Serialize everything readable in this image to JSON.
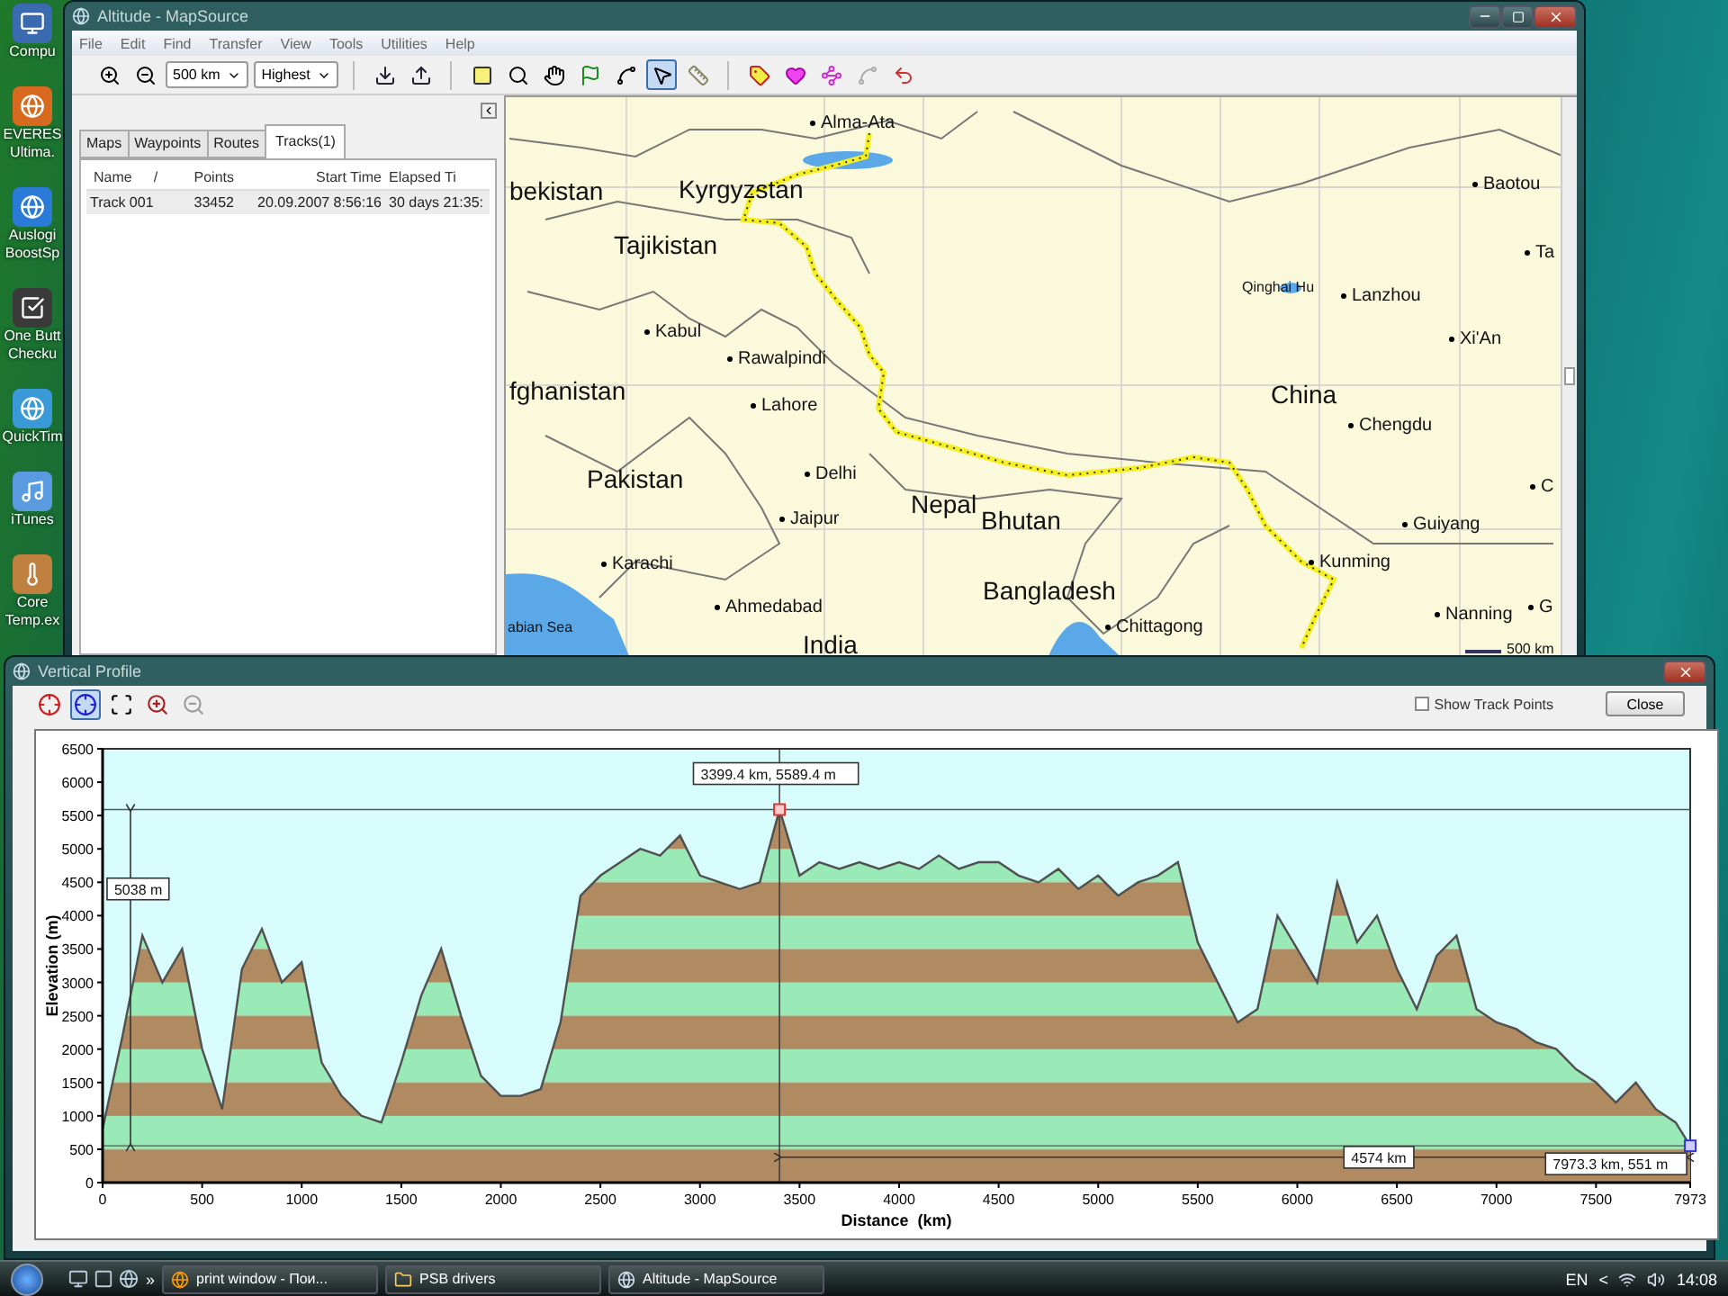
{
  "desktop_icons": [
    {
      "label": "Compu"
    },
    {
      "label": "EVERES Ultima."
    },
    {
      "label": "Auslogi BoostSp"
    },
    {
      "label": "One Butt Checku"
    },
    {
      "label": "QuickTim"
    },
    {
      "label": "iTunes"
    },
    {
      "label": "Core Temp.ex"
    }
  ],
  "mapsource": {
    "title": "Altitude - MapSource",
    "menu": [
      "File",
      "Edit",
      "Find",
      "Transfer",
      "View",
      "Tools",
      "Utilities",
      "Help"
    ],
    "scale_select": "500 km",
    "detail_select": "Highest",
    "tools": [
      {
        "selected": false
      },
      {
        "selected": false
      },
      {
        "selected": false
      },
      {
        "selected": false
      },
      {
        "selected": false
      },
      {
        "selected": false
      },
      {
        "selected": false
      },
      {
        "selected": false
      },
      {
        "selected": false
      },
      {
        "selected": true
      },
      {
        "selected": false
      },
      {
        "selected": false
      },
      {
        "selected": false
      },
      {
        "selected": false
      },
      {
        "selected": false
      },
      {
        "selected": false
      }
    ],
    "tabs": [
      {
        "label": "Maps",
        "selected": false
      },
      {
        "label": "Waypoints",
        "selected": false
      },
      {
        "label": "Routes",
        "selected": false
      },
      {
        "label": "Tracks(1)",
        "selected": true
      }
    ],
    "table": {
      "columns": [
        "Name",
        "Points",
        "Start Time",
        "Elapsed Ti"
      ],
      "sort_mark": "/",
      "rows": [
        [
          "Track 001",
          "33452",
          "20.09.2007 8:56:16",
          "30 days 21:35:"
        ]
      ]
    },
    "map": {
      "places": [
        {
          "kind": "city",
          "name": "Alma-Ata"
        },
        {
          "kind": "country",
          "name": "bekistan"
        },
        {
          "kind": "country",
          "name": "Kyrgyzstan"
        },
        {
          "kind": "city",
          "name": "Baotou"
        },
        {
          "kind": "country",
          "name": "Tajikistan"
        },
        {
          "kind": "city",
          "name": "Ta"
        },
        {
          "kind": "water",
          "name": "Qinghai Hu"
        },
        {
          "kind": "city",
          "name": "Lanzhou"
        },
        {
          "kind": "city",
          "name": "Kabul"
        },
        {
          "kind": "city",
          "name": "Xi'An"
        },
        {
          "kind": "city",
          "name": "Rawalpindi"
        },
        {
          "kind": "country",
          "name": "fghanistan"
        },
        {
          "kind": "country",
          "name": "China"
        },
        {
          "kind": "city",
          "name": "Lahore"
        },
        {
          "kind": "city",
          "name": "Chengdu"
        },
        {
          "kind": "country",
          "name": "Pakistan"
        },
        {
          "kind": "city",
          "name": "Delhi"
        },
        {
          "kind": "city",
          "name": "Jaipur"
        },
        {
          "kind": "country",
          "name": "Nepal"
        },
        {
          "kind": "country",
          "name": "Bhutan"
        },
        {
          "kind": "city",
          "name": "C"
        },
        {
          "kind": "city",
          "name": "Guiyang"
        },
        {
          "kind": "city",
          "name": "Karachi"
        },
        {
          "kind": "city",
          "name": "Kunming"
        },
        {
          "kind": "country",
          "name": "Bangladesh"
        },
        {
          "kind": "city",
          "name": "Ahmedabad"
        },
        {
          "kind": "city",
          "name": "Nanning"
        },
        {
          "kind": "city",
          "name": "G"
        },
        {
          "kind": "city",
          "name": "Chittagong"
        },
        {
          "kind": "water",
          "name": "abian Sea"
        },
        {
          "kind": "country",
          "name": "India"
        },
        {
          "kind": "scale",
          "name": "500 km"
        }
      ]
    }
  },
  "profile": {
    "title": "Vertical Profile",
    "tools": [
      {
        "selected": false,
        "disabled": false
      },
      {
        "selected": true,
        "disabled": false
      },
      {
        "selected": false,
        "disabled": false
      },
      {
        "selected": false,
        "disabled": false
      },
      {
        "selected": false,
        "disabled": true
      }
    ],
    "show_track_points": {
      "label": "Show Track Points",
      "checked": false
    },
    "close_button": "Close",
    "chart_data": {
      "type": "area",
      "xlabel": "Distance  (km)",
      "ylabel": "Elevation (m)",
      "x": [
        0,
        100,
        200,
        300,
        400,
        500,
        600,
        700,
        800,
        900,
        1000,
        1100,
        1200,
        1300,
        1400,
        1500,
        1600,
        1700,
        1800,
        1900,
        2000,
        2100,
        2200,
        2300,
        2400,
        2500,
        2600,
        2700,
        2800,
        2900,
        3000,
        3100,
        3200,
        3300,
        3400,
        3500,
        3600,
        3700,
        3800,
        3900,
        4000,
        4100,
        4200,
        4300,
        4400,
        4500,
        4600,
        4700,
        4800,
        4900,
        5000,
        5100,
        5200,
        5300,
        5400,
        5500,
        5600,
        5700,
        5800,
        5900,
        6000,
        6100,
        6200,
        6300,
        6400,
        6500,
        6600,
        6700,
        6800,
        6900,
        7000,
        7100,
        7200,
        7300,
        7400,
        7500,
        7600,
        7700,
        7800,
        7900,
        7973
      ],
      "series": [
        {
          "color": "#505050",
          "values": [
            800,
            2200,
            3700,
            3000,
            3500,
            2000,
            1100,
            3200,
            3800,
            3000,
            3300,
            1800,
            1300,
            1000,
            900,
            1800,
            2800,
            3500,
            2500,
            1600,
            1300,
            1300,
            1400,
            2400,
            4300,
            4600,
            4800,
            5000,
            4900,
            5200,
            4600,
            4500,
            4400,
            4500,
            5590,
            4600,
            4800,
            4700,
            4800,
            4700,
            4800,
            4700,
            4900,
            4700,
            4800,
            4800,
            4600,
            4500,
            4700,
            4400,
            4600,
            4300,
            4500,
            4600,
            4800,
            3600,
            3000,
            2400,
            2600,
            4000,
            3500,
            3000,
            4500,
            3600,
            4000,
            3200,
            2600,
            3400,
            3700,
            2600,
            2400,
            2300,
            2100,
            2000,
            1700,
            1500,
            1200,
            1500,
            1100,
            900,
            550
          ]
        }
      ],
      "xlim": [
        0,
        7973
      ],
      "ylim": [
        0,
        6500
      ],
      "xticks": [
        0,
        500,
        1000,
        1500,
        2000,
        2500,
        3000,
        3500,
        4000,
        4500,
        5000,
        5500,
        6000,
        6500,
        7000,
        7500,
        7973
      ],
      "yticks": [
        0,
        500,
        1000,
        1500,
        2000,
        2500,
        3000,
        3500,
        4000,
        4500,
        5000,
        5500,
        6000,
        6500
      ],
      "ref_lines": [
        {
          "axis": "y",
          "value": 5589.4
        },
        {
          "axis": "y",
          "value": 551
        },
        {
          "axis": "x",
          "value": 3399.4
        }
      ],
      "annotations": [
        {
          "text": "3399.4 km, 5589.4 m",
          "x": 3399.4,
          "y": 5589.4
        },
        "5038 m",
        "4574 km",
        {
          "text": "7973.3 km, 551 m",
          "x": 7973.3,
          "y": 551
        }
      ]
    }
  },
  "taskbar": {
    "overflow": "»",
    "tasks": [
      {
        "label": "print window - Пои..."
      },
      {
        "label": "PSB drivers"
      },
      {
        "label": "Altitude - MapSource"
      }
    ],
    "language": "EN",
    "tray_toggle": "<",
    "clock": "14:08"
  }
}
